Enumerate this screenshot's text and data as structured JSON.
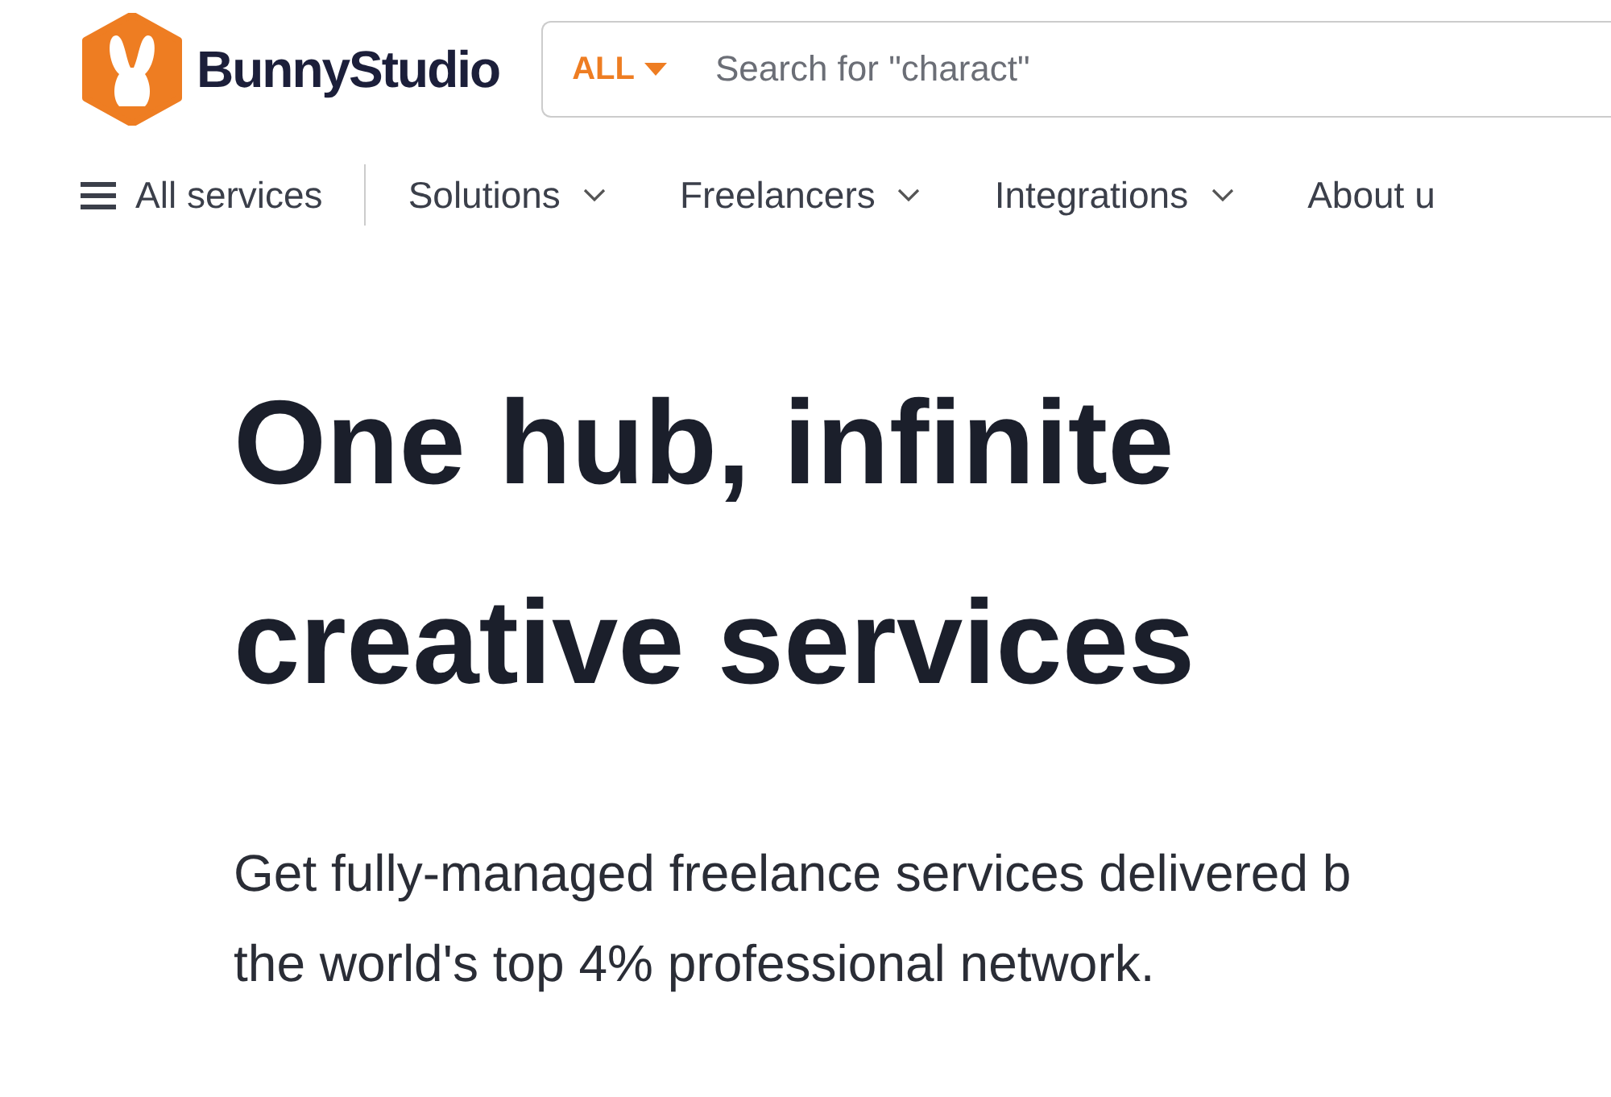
{
  "logo": {
    "text": "BunnyStudio"
  },
  "search": {
    "category": "ALL",
    "placeholder": "Search for \"charact\""
  },
  "nav": {
    "menu_label": "All services",
    "items": [
      {
        "label": "Solutions",
        "dropdown": true
      },
      {
        "label": "Freelancers",
        "dropdown": true
      },
      {
        "label": "Integrations",
        "dropdown": true
      },
      {
        "label": "About u",
        "dropdown": false
      }
    ]
  },
  "hero": {
    "headline_lines": [
      "One hub, infinite",
      "creative services"
    ],
    "subtitle_lines": [
      "Get fully-managed freelance services delivered b",
      "the world's top 4% professional network."
    ]
  }
}
